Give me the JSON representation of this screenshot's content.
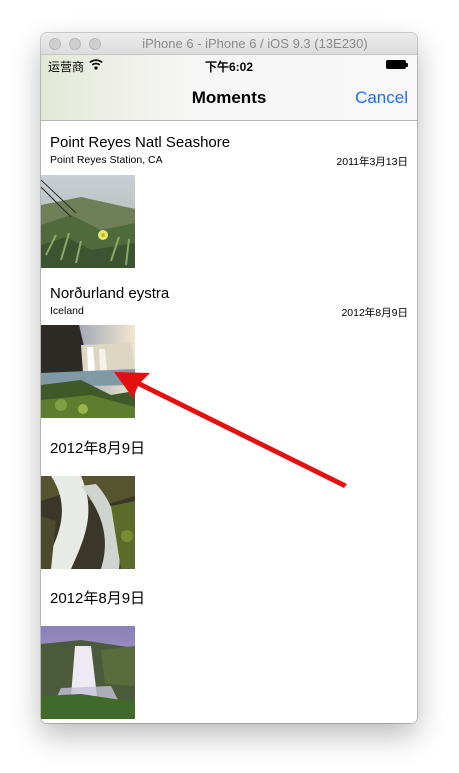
{
  "window": {
    "title": "iPhone 6 - iPhone 6 / iOS 9.3 (13E230)"
  },
  "status_bar": {
    "carrier": "运营商",
    "time": "下午6:02"
  },
  "nav": {
    "title": "Moments",
    "cancel_label": "Cancel"
  },
  "moments": [
    {
      "title": "Point Reyes Natl Seashore",
      "location": "Point Reyes Station, CA",
      "date": "2011年3月13日"
    },
    {
      "title": "Norðurland eystra",
      "location": "Iceland",
      "date": "2012年8月9日"
    },
    {
      "title": "2012年8月9日"
    },
    {
      "title": "2012年8月9日"
    }
  ],
  "annotation": {
    "arrow_color": "#e31010"
  }
}
